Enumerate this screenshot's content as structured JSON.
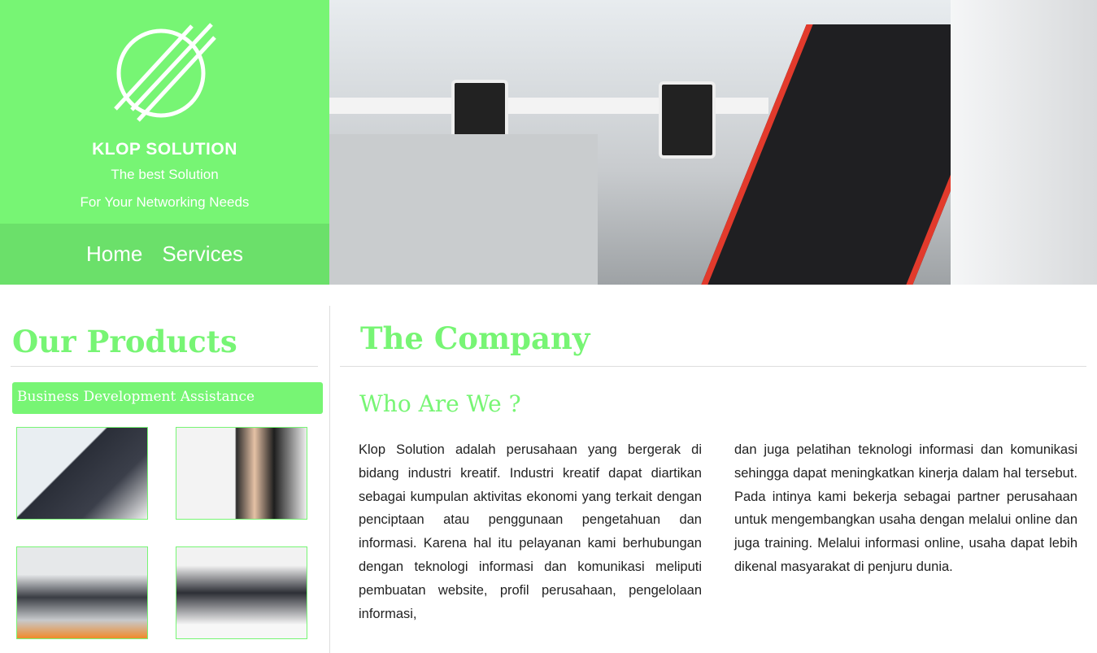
{
  "brand": {
    "name": "KLOP SOLUTION",
    "tagline1": "The best Solution",
    "tagline2": "For Your Networking Needs",
    "accent": "#77f574"
  },
  "nav": {
    "items": [
      {
        "label": "Home"
      },
      {
        "label": "Services"
      }
    ]
  },
  "products": {
    "title": "Our Products",
    "category": "Business Development Assistance"
  },
  "company": {
    "title": "The Company",
    "subtitle": "Who Are We ?",
    "col1": "Klop Solution adalah perusahaan yang bergerak di bidang industri kreatif. Industri kreatif dapat diartikan sebagai kumpulan aktivitas ekonomi yang terkait dengan penciptaan atau penggunaan pengetahuan dan informasi. Karena hal itu pelayanan kami berhubungan dengan teknologi informasi dan komunikasi meliputi pembuatan website, profil perusahaan, pengelolaan informasi,",
    "col2": "dan juga pelatihan teknologi informasi dan komunikasi sehingga dapat meningkatkan kinerja dalam hal tersebut. Pada intinya kami bekerja sebagai partner perusahaan untuk mengembangkan usaha dengan melalui online dan juga training. Melalui informasi online, usaha dapat lebih dikenal masyarakat di penjuru dunia."
  }
}
